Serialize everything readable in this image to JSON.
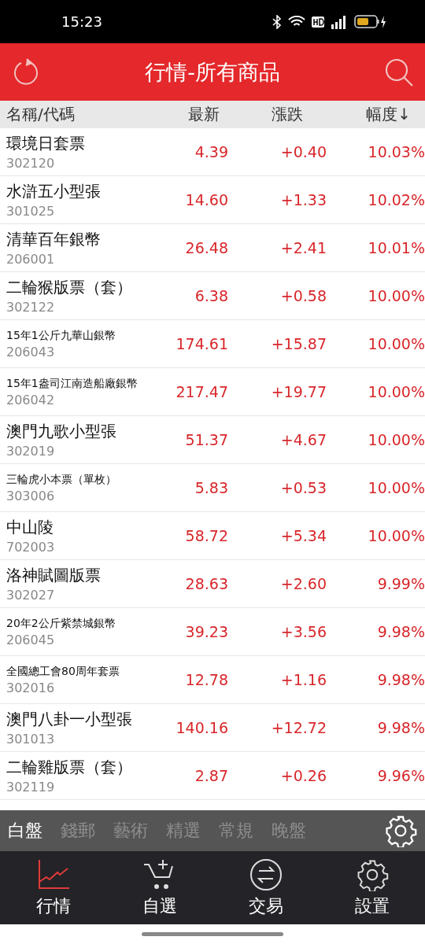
{
  "status_bar": {
    "time": "15:23"
  },
  "header": {
    "title": "行情-所有商品"
  },
  "table": {
    "columns": [
      {
        "label": "名稱/代碼"
      },
      {
        "label": "最新"
      },
      {
        "label": "漲跌"
      },
      {
        "label": "幅度↓"
      }
    ],
    "rows": [
      {
        "name": "環境日套票",
        "code": "302120",
        "price": "4.39",
        "change": "+0.40",
        "pct": "10.03%"
      },
      {
        "name": "水滸五小型張",
        "code": "301025",
        "price": "14.60",
        "change": "+1.33",
        "pct": "10.02%"
      },
      {
        "name": "清華百年銀幣",
        "code": "206001",
        "price": "26.48",
        "change": "+2.41",
        "pct": "10.01%"
      },
      {
        "name": "二輪猴版票（套）",
        "code": "302122",
        "price": "6.38",
        "change": "+0.58",
        "pct": "10.00%"
      },
      {
        "name": "15年1公斤九華山銀幣",
        "code": "206043",
        "price": "174.61",
        "change": "+15.87",
        "pct": "10.00%"
      },
      {
        "name": "15年1盎司江南造船廠銀幣",
        "code": "206042",
        "price": "217.47",
        "change": "+19.77",
        "pct": "10.00%"
      },
      {
        "name": "澳門九歌小型張",
        "code": "302019",
        "price": "51.37",
        "change": "+4.67",
        "pct": "10.00%"
      },
      {
        "name": "三輪虎小本票（單枚）",
        "code": "303006",
        "price": "5.83",
        "change": "+0.53",
        "pct": "10.00%"
      },
      {
        "name": "中山陵",
        "code": "702003",
        "price": "58.72",
        "change": "+5.34",
        "pct": "10.00%"
      },
      {
        "name": "洛神賦圖版票",
        "code": "302027",
        "price": "28.63",
        "change": "+2.60",
        "pct": "9.99%"
      },
      {
        "name": "20年2公斤紫禁城銀幣",
        "code": "206045",
        "price": "39.23",
        "change": "+3.56",
        "pct": "9.98%"
      },
      {
        "name": "全國總工會80周年套票",
        "code": "302016",
        "price": "12.78",
        "change": "+1.16",
        "pct": "9.98%"
      },
      {
        "name": "澳門八卦一小型張",
        "code": "301013",
        "price": "140.16",
        "change": "+12.72",
        "pct": "9.98%"
      },
      {
        "name": "二輪雞版票（套）",
        "code": "302119",
        "price": "2.87",
        "change": "+0.26",
        "pct": "9.96%"
      }
    ]
  },
  "categories": [
    {
      "label": "白盤",
      "selected": true
    },
    {
      "label": "錢郵",
      "selected": false
    },
    {
      "label": "藝術",
      "selected": false
    },
    {
      "label": "精選",
      "selected": false
    },
    {
      "label": "常規",
      "selected": false
    },
    {
      "label": "晚盤",
      "selected": false
    }
  ],
  "nav": [
    {
      "label": "行情",
      "kind": "chart",
      "selected": true
    },
    {
      "label": "自選",
      "kind": "cart",
      "selected": false
    },
    {
      "label": "交易",
      "kind": "exchange",
      "selected": false
    },
    {
      "label": "設置",
      "kind": "settings",
      "selected": false
    }
  ]
}
